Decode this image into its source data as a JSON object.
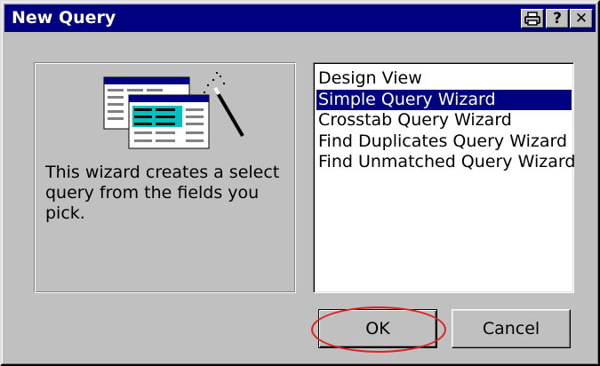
{
  "window": {
    "title": "New Query",
    "buttons": {
      "print": "print-icon",
      "help": "?",
      "close": "✕"
    }
  },
  "left_panel": {
    "illustration_icon": "query-wizard-illustration-icon",
    "description": "This wizard creates a select query from the fields you pick."
  },
  "list": {
    "items": [
      {
        "label": "Design View",
        "selected": false
      },
      {
        "label": "Simple Query Wizard",
        "selected": true
      },
      {
        "label": "Crosstab Query Wizard",
        "selected": false
      },
      {
        "label": "Find Duplicates Query Wizard",
        "selected": false
      },
      {
        "label": "Find Unmatched Query Wizard",
        "selected": false
      }
    ]
  },
  "actions": {
    "ok_label": "OK",
    "cancel_label": "Cancel"
  },
  "colors": {
    "titlebar": "#000080",
    "selection": "#000080",
    "annotation": "#e02020"
  }
}
